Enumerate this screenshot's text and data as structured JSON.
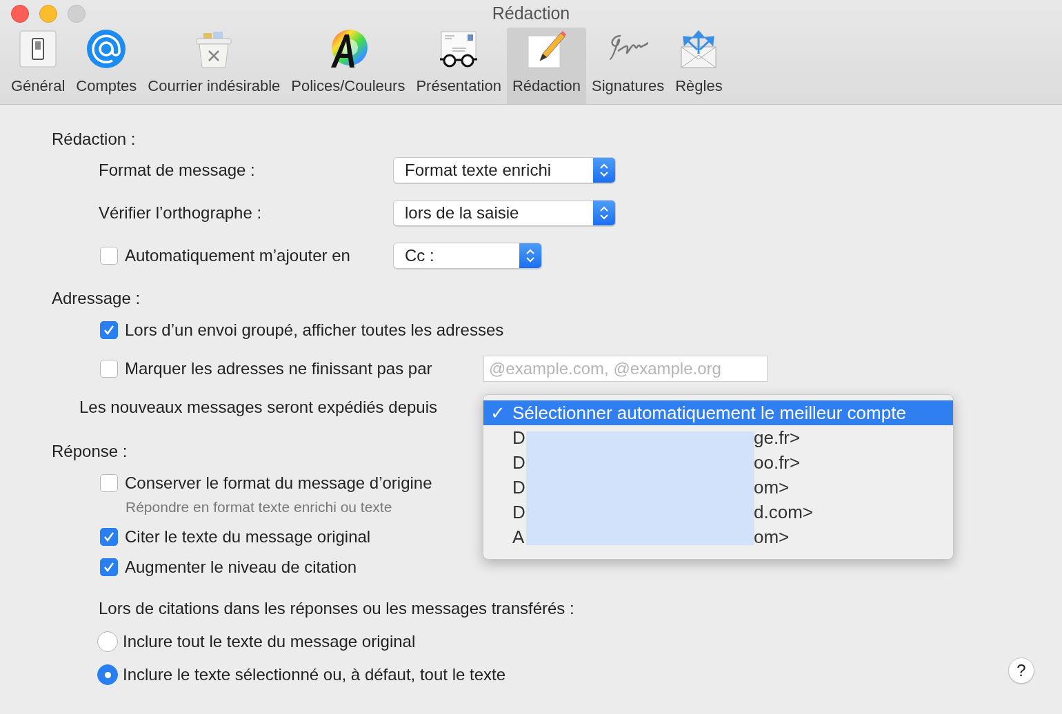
{
  "window": {
    "title": "Rédaction"
  },
  "toolbar": [
    {
      "label": "Général",
      "selected": false,
      "kind": "switch"
    },
    {
      "label": "Comptes",
      "selected": false,
      "kind": "at"
    },
    {
      "label": "Courrier indésirable",
      "selected": false,
      "kind": "trash"
    },
    {
      "label": "Polices/Couleurs",
      "selected": false,
      "kind": "font"
    },
    {
      "label": "Présentation",
      "selected": false,
      "kind": "glasses"
    },
    {
      "label": "Rédaction",
      "selected": true,
      "kind": "pencil"
    },
    {
      "label": "Signatures",
      "selected": false,
      "kind": "signature"
    },
    {
      "label": "Règles",
      "selected": false,
      "kind": "rules"
    }
  ],
  "composing": {
    "heading": "Rédaction :",
    "message_format": {
      "label": "Format de message :",
      "value": "Format texte enrichi"
    },
    "spell_check": {
      "label": "Vérifier l’orthographe :",
      "value": "lors de la saisie"
    },
    "auto_add": {
      "label": "Automatiquement m’ajouter en",
      "checked": false,
      "value": "Cc :"
    }
  },
  "addressing": {
    "heading": "Adressage :",
    "show_all": {
      "label": "Lors d’un envoi groupé, afficher toutes les adresses",
      "checked": true
    },
    "mark": {
      "label": "Marquer les adresses ne finissant pas par",
      "checked": false,
      "placeholder": "@example.com, @example.org"
    },
    "send_from": {
      "label": "Les nouveaux messages seront expédiés depuis"
    }
  },
  "send_from_menu": {
    "check_symbol": "✓",
    "items": [
      {
        "label": "Sélectionner automatiquement le meilleur compte",
        "selected": true
      },
      {
        "start": "D",
        "end": "ge.fr>",
        "selected": false
      },
      {
        "start": "D",
        "end": "oo.fr>",
        "selected": false
      },
      {
        "start": "D",
        "end": "om>",
        "selected": false
      },
      {
        "start": "D",
        "end": "d.com>",
        "selected": false
      },
      {
        "start": "A",
        "end": "om>",
        "selected": false
      }
    ]
  },
  "reply": {
    "heading": "Réponse :",
    "options": [
      {
        "label": "Conserver le format du message d’origine",
        "checked": false,
        "note": "Répondre en format texte enrichi ou texte"
      },
      {
        "label": "Citer le texte du message original",
        "checked": true
      },
      {
        "label": "Augmenter le niveau de citation",
        "checked": true
      }
    ],
    "quoting": {
      "label": "Lors de citations dans les réponses ou les messages transférés :",
      "choices": [
        {
          "label": "Inclure tout le texte du message original",
          "selected": false
        },
        {
          "label": "Inclure le texte sélectionné ou, à défaut, tout le texte",
          "selected": true
        }
      ]
    }
  },
  "help": {
    "label": "?"
  }
}
